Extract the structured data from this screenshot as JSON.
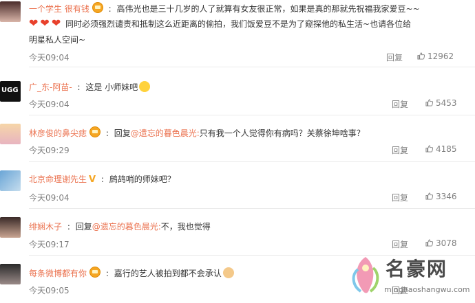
{
  "comments": [
    {
      "user": "一个学生 很有钱",
      "badge": "vip",
      "sep": ":",
      "text_line1": "高伟光也是三十几岁的人了就算有女友很正常，如果是真的那就先祝福我家爱豆~~",
      "text_line2": "同时必须强烈谴责和抵制这么近距离的偷拍，我们饭爱豆不是为了窥探他的私生活~也请各位给",
      "text_line3": "明星私人空间~",
      "time": "今天09:04",
      "reply": "回复",
      "likes": "12962"
    },
    {
      "user": "广_东-阿苗-",
      "sep": ":",
      "text": "这是 小师妹吧",
      "time": "今天09:04",
      "reply": "回复",
      "likes": "5453"
    },
    {
      "user": "林彦俊的鼻尖痣",
      "badge": "vip",
      "sep": ":",
      "reply_prefix": "回复",
      "mention": "@遗忘的暮色晨光:",
      "text": "只有我一个人觉得你有病吗？关蔡徐坤啥事？",
      "time": "今天09:29",
      "reply": "回复",
      "likes": "4185"
    },
    {
      "user": "北京命理谢先生",
      "badge": "V",
      "sep": ":",
      "text": "鹧鸪哨的师妹吧？",
      "time": "今天09:04",
      "reply": "回复",
      "likes": "3346"
    },
    {
      "user": "绯娴木子",
      "sep": ":",
      "reply_prefix": "回复",
      "mention": "@遗忘的暮色晨光:",
      "text": "不，我也觉得",
      "time": "今天09:17",
      "reply": "回复",
      "likes": "3078"
    },
    {
      "user": "每条微博都有你",
      "badge": "vip",
      "sep": ":",
      "text": "嘉行的艺人被拍到都不会承认",
      "time": "今天09:05",
      "reply": "回复"
    }
  ],
  "watermark": {
    "title": "名豪网",
    "url": "minghaoshangwu.com"
  },
  "colors": {
    "username": "#eb7350",
    "meta": "#808080",
    "heart": "#e8412c"
  },
  "icons": [
    "avatar",
    "vip-badge-icon",
    "heart-emoji-icon",
    "grin-emoji-icon",
    "thumbs-up-icon",
    "verified-v-icon",
    "logo-icon"
  ]
}
